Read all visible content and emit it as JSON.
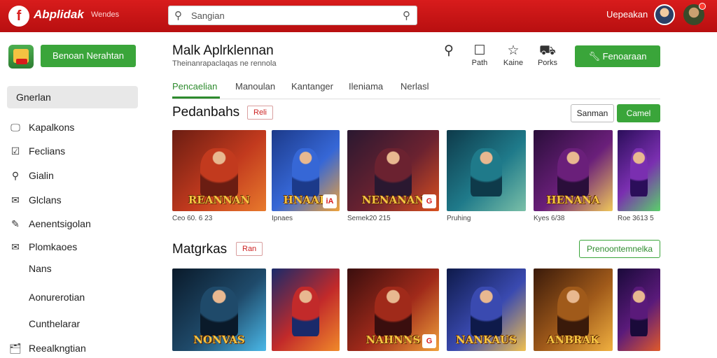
{
  "topbar": {
    "logo_letter": "f",
    "brand": "Abplidak",
    "brand_sub": "Wendes",
    "search_placeholder": "Sangian",
    "user_name": "Uepeakan"
  },
  "sidebar": {
    "cta_label": "Benoan Nerahtan",
    "active_item": "Gnerlan",
    "items": [
      {
        "icon": "monitor-icon",
        "glyph": "🖵",
        "label": "Kapalkons"
      },
      {
        "icon": "checklist-icon",
        "glyph": "☑",
        "label": "Feclians"
      },
      {
        "icon": "location-icon",
        "glyph": "⚲",
        "label": "Gialin"
      },
      {
        "icon": "mail-icon",
        "glyph": "✉",
        "label": "Glclans"
      },
      {
        "icon": "pen-icon",
        "glyph": "✎",
        "label": "Aenentsigolan"
      },
      {
        "icon": "inbox-icon",
        "glyph": "✉",
        "label": "Plomkaoes"
      }
    ],
    "sub_items": [
      "Nans",
      "Aonurerotian",
      "Cunthelarar"
    ],
    "bottom_item": {
      "icon": "gift-icon",
      "glyph": "🗂",
      "label": "Reealkngtian"
    }
  },
  "header": {
    "title": "Malk Aplrklennan",
    "subtitle": "Theinanrapaclaqas ne rennola",
    "actions": [
      {
        "icon": "search-icon",
        "glyph": "⚲",
        "label": ""
      },
      {
        "icon": "chat-icon",
        "glyph": "☐",
        "label": "Path"
      },
      {
        "icon": "star-icon",
        "glyph": "☆",
        "label": "Kaine"
      },
      {
        "icon": "cart-icon",
        "glyph": "⛟",
        "label": "Porks"
      }
    ],
    "install_label": "Fenoaraan"
  },
  "tabs": [
    "Pencaelian",
    "Manoulan",
    "Kantanger",
    "Ileniama",
    "Nerlasl"
  ],
  "section1": {
    "title": "Pedanbahs",
    "badge": "Reli",
    "btn_outline": "Sanman",
    "btn_green": "Camel",
    "cards": [
      {
        "art": "REANNAN",
        "caption": "Ceo 60. 6 23",
        "badge": "",
        "colors": [
          "#6b1d12",
          "#c23a1e",
          "#e87a2c"
        ]
      },
      {
        "art": "HNAAR",
        "caption": "Ipnaes",
        "badge": "iA",
        "colors": [
          "#1c3a8a",
          "#3667d6",
          "#f0a33a"
        ]
      },
      {
        "art": "NENANAN",
        "caption": "Semek20 215",
        "badge": "G",
        "colors": [
          "#2a1830",
          "#6b2230",
          "#d9501f"
        ]
      },
      {
        "art": "",
        "caption": "Pruhing",
        "badge": "",
        "colors": [
          "#0e3a4a",
          "#1f7a8a",
          "#7bc0a8"
        ]
      },
      {
        "art": "HENANA",
        "caption": "Kyes 6/38",
        "badge": "",
        "colors": [
          "#2a0e3a",
          "#6a1f7a",
          "#f0c85a"
        ]
      },
      {
        "art": "",
        "caption": "Roe 3613 5",
        "badge": "",
        "colors": [
          "#2b0e5a",
          "#7a2fb0",
          "#5ad06a"
        ]
      }
    ]
  },
  "section2": {
    "title": "Matgrkas",
    "badge": "Ran",
    "btn_green_outline": "Prenoontemnelka",
    "cards": [
      {
        "art": "NONVAS",
        "caption": "",
        "badge": "",
        "colors": [
          "#0a1a2a",
          "#1f4a6a",
          "#4ab8e8"
        ]
      },
      {
        "art": "",
        "caption": "",
        "badge": "",
        "colors": [
          "#1a2a6a",
          "#c22a2a",
          "#f08a2a"
        ]
      },
      {
        "art": "NAHNNS",
        "caption": "",
        "badge": "G",
        "colors": [
          "#3a0e0e",
          "#a02a1a",
          "#f0a03a"
        ]
      },
      {
        "art": "NANKAUS",
        "caption": "",
        "badge": "",
        "colors": [
          "#0e1a4a",
          "#3a4ab0",
          "#f0c050"
        ]
      },
      {
        "art": "ANBRAK",
        "caption": "",
        "badge": "",
        "colors": [
          "#3a1a0a",
          "#a05a1a",
          "#f0b040"
        ]
      },
      {
        "art": "",
        "caption": "",
        "badge": "",
        "colors": [
          "#1a0a3a",
          "#5a1a7a",
          "#e05a2a"
        ]
      }
    ]
  }
}
